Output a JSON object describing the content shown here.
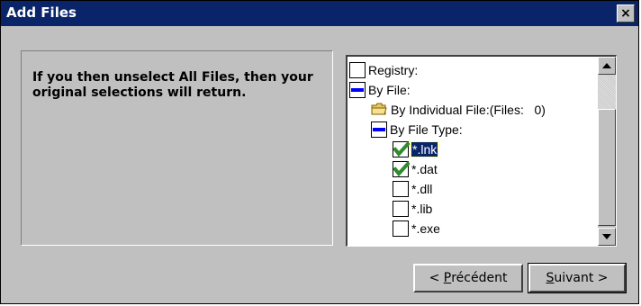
{
  "window": {
    "title": "Add Files",
    "close_label": "×"
  },
  "message": {
    "text": "If you then unselect All Files, then your original selections will return."
  },
  "tree": {
    "items": [
      {
        "label": "Registry:",
        "checkbox": "unchecked"
      },
      {
        "label": "By File:",
        "checkbox": "partial"
      },
      {
        "label": "By Individual File:(Files:   0)",
        "icon": "folder-icon"
      },
      {
        "label": "By File Type:",
        "checkbox": "partial"
      },
      {
        "label": "*.lnk",
        "checkbox": "checked",
        "selected": true
      },
      {
        "label": "*.dat",
        "checkbox": "checked"
      },
      {
        "label": "*.dll",
        "checkbox": "unchecked"
      },
      {
        "label": "*.lib",
        "checkbox": "unchecked"
      },
      {
        "label": "*.exe",
        "checkbox": "unchecked"
      }
    ]
  },
  "buttons": {
    "back_prefix": "< ",
    "back_mnemonic": "P",
    "back_rest": "récédent",
    "next_mnemonic": "S",
    "next_rest": "uivant >"
  },
  "colors": {
    "titlebar": "#0a246a",
    "face": "#c0c0c0",
    "check_green": "#2e8b2e",
    "partial_blue": "#0000ff"
  }
}
